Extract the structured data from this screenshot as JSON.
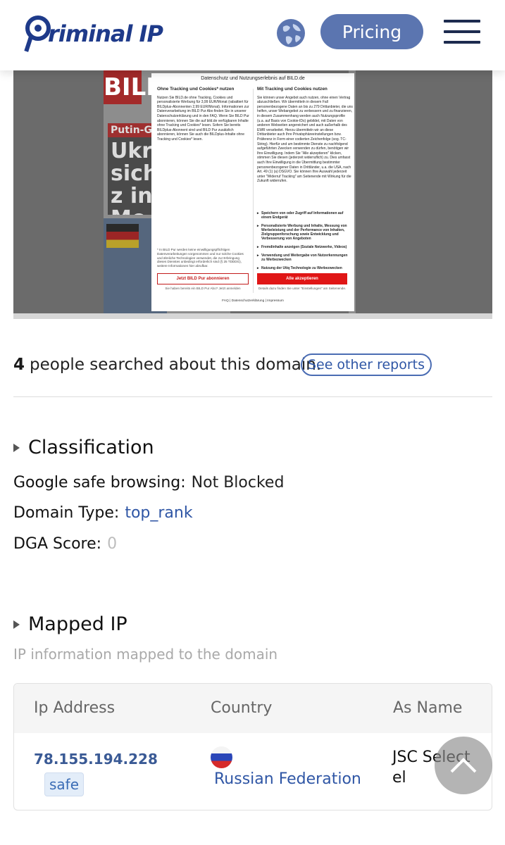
{
  "header": {
    "logo_text": "riminal IP",
    "pricing_label": "Pricing",
    "globe_icon": "globe-icon",
    "menu_icon": "hamburger-icon"
  },
  "preview": {
    "bild_logo": "BILD",
    "headline_tag": "Putin-Gen",
    "headline": "Ukrai sich z in Mo",
    "modal": {
      "title": "Datenschutz und Nutzungserlebnis auf BILD.de",
      "left_heading": "Ohne Tracking und Cookies* nutzen",
      "left_body": "Nutzen Sie BILD.de ohne Tracking, Cookies und personalisierte Werbung für 3,99 EUR/Monat (rabattiert für BILDplus-Abonnenten 2,99 EUR/Monat). Informationen zur Datenverarbeitung im BILD Pur Abo finden Sie in unserer Datenschutzerklärung und in den FAQ. Wenn Sie BILD Pur abonnieren, können Sie die auf bild.de verfügbaren Inhalte ohne Tracking und Cookies* lesen. Sofern Sie bereits BILDplus-Abonnent sind und BILD Pur zusätzlich abonnieren, können Sie auch die BILDplus-Inhalte ohne Tracking und Cookies* lesen.",
      "right_heading": "Mit Tracking und Cookies nutzen",
      "right_body": "Sie können unser Angebot auch nutzen, ohne einen Vertrag abzuschließen. Wir übermitteln in diesem Fall personenbezogene Daten an bis zu 279 Drittanbieter, die uns helfen, unser Webangebot zu verbessern und zu finanzieren, in diesem Zusammenhang werden auch Nutzungsprofile (u.a. auf Basis von Cookie-IDs) gebildet, mit Daten von anderen Webseiten angereichert und auch außerhalb des EWR verarbeitet. Hierzu übermitteln wir an diese Drittanbieter auch Ihre Privatsphäreeinstellungen bzw. Präferenz in Form einer codierten Zeichenfolge (sog. TC-String). Hierfür und um bestimmte Dienste zu nachfolgend aufgeführten Zwecken verwenden zu dürfen, benötigen wir Ihre Einwilligung. Indem Sie \"Alle akzeptieren\" klicken, stimmen Sie diesen (jederzeit widerruflich) zu. Dies umfasst auch Ihre Einwilligung in die Übermittlung bestimmter personenbezogener Daten in Drittländer, u.a. die USA, nach Art. 49 (1) (a) DSGVO. Sie können Ihre Auswahl jederzeit unter \"Widerruf Tracking\" am Seitenende mit Wirkung für die Zukunft widerrufen.",
      "bullets": [
        "Speichern von oder Zugriff auf Informationen auf einem Endgerät",
        "Personalisierte Werbung und Inhalte, Messung von Werbeleistung und der Performance von Inhalten, Zielgruppenforschung sowie Entwicklung und Verbesserung von Angeboten",
        "Fremdinhalte anzeigen (Soziale Netzwerke, Videos)",
        "Verwendung und Weitergabe von Nutzerkennungen zu Werbezwecken",
        "Nutzung der Utiq Technologie zu Werbezwecken"
      ],
      "footnote": "* In BILD Pur werden keine einwilligungspflichtigen Datenverarbeitungen vorgenommen und nur solche Cookies und ähnliche Technologien verwendet, die zur Erbringung dieses Dienstes unbedingt erforderlich sind (§ 25 TDDDG), weitere Informationen hier abrufbar.",
      "subscribe_label": "Jetzt BILD Pur abonnieren",
      "accept_label": "Alle akzeptieren",
      "left_note": "Sie haben bereits ein BILD Pur Abo? Jetzt anmelden",
      "right_note": "Details dazu finden Sie unter \"Einstellungen\" am Seitenende.",
      "links": "FAQ | Datenschutzerklärung | Impressum"
    }
  },
  "search": {
    "count": "4",
    "text": "people searched about this domain.",
    "see_reports": "See other reports"
  },
  "classification": {
    "title": "Classification",
    "google_label": "Google safe browsing:",
    "google_value": "Not Blocked",
    "domain_type_label": "Domain Type:",
    "domain_type_value": "top_rank",
    "dga_label": "DGA Score:",
    "dga_value": "0"
  },
  "mapped_ip": {
    "title": "Mapped IP",
    "subtitle": "IP information mapped to the domain",
    "columns": [
      "Ip Address",
      "Country",
      "As Name"
    ],
    "rows": [
      {
        "ip": "78.155.194.228",
        "badge": "safe",
        "country": "Russian Federation",
        "as_name": "JSC Select el"
      }
    ]
  },
  "scroll_top_icon": "chevron-up-icon"
}
